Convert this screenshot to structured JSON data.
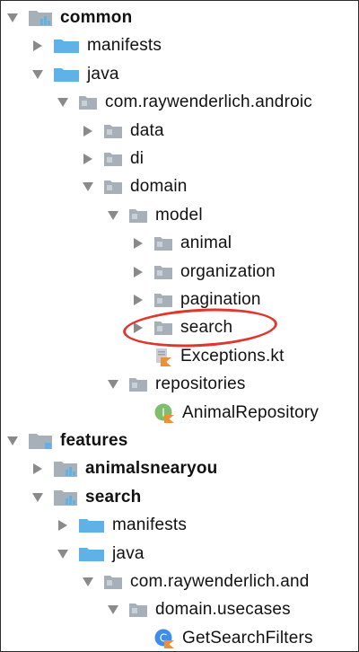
{
  "tree": {
    "rows": [
      {
        "label": "common",
        "depth": 0,
        "expanded": true,
        "icon": "module-folder-icon",
        "bold": true
      },
      {
        "label": "manifests",
        "depth": 1,
        "expanded": false,
        "icon": "folder-blue-icon",
        "bold": false
      },
      {
        "label": "java",
        "depth": 1,
        "expanded": true,
        "icon": "folder-blue-icon",
        "bold": false
      },
      {
        "label": "com.raywenderlich.androic",
        "depth": 2,
        "expanded": true,
        "icon": "package-folder-icon",
        "bold": false
      },
      {
        "label": "data",
        "depth": 3,
        "expanded": false,
        "icon": "package-folder-icon",
        "bold": false
      },
      {
        "label": "di",
        "depth": 3,
        "expanded": false,
        "icon": "package-folder-icon",
        "bold": false
      },
      {
        "label": "domain",
        "depth": 3,
        "expanded": true,
        "icon": "package-folder-icon",
        "bold": false
      },
      {
        "label": "model",
        "depth": 4,
        "expanded": true,
        "icon": "package-folder-icon",
        "bold": false
      },
      {
        "label": "animal",
        "depth": 5,
        "expanded": false,
        "icon": "package-folder-icon",
        "bold": false
      },
      {
        "label": "organization",
        "depth": 5,
        "expanded": false,
        "icon": "package-folder-icon",
        "bold": false
      },
      {
        "label": "pagination",
        "depth": 5,
        "expanded": false,
        "icon": "package-folder-icon",
        "bold": false
      },
      {
        "label": "search",
        "depth": 5,
        "expanded": false,
        "icon": "package-folder-icon",
        "bold": false,
        "highlighted": true
      },
      {
        "label": "Exceptions.kt",
        "depth": 5,
        "expanded": null,
        "icon": "kotlin-file-icon",
        "bold": false
      },
      {
        "label": "repositories",
        "depth": 4,
        "expanded": true,
        "icon": "package-folder-icon",
        "bold": false
      },
      {
        "label": "AnimalRepository",
        "depth": 5,
        "expanded": null,
        "icon": "kotlin-interface-icon",
        "bold": false
      },
      {
        "label": "features",
        "depth": 0,
        "expanded": true,
        "icon": "folder-plain-icon",
        "bold": true
      },
      {
        "label": "animalsnearyou",
        "depth": 1,
        "expanded": false,
        "icon": "module-folder-icon",
        "bold": true
      },
      {
        "label": "search",
        "depth": 1,
        "expanded": true,
        "icon": "module-folder-icon",
        "bold": true
      },
      {
        "label": "manifests",
        "depth": 2,
        "expanded": false,
        "icon": "folder-blue-icon",
        "bold": false
      },
      {
        "label": "java",
        "depth": 2,
        "expanded": true,
        "icon": "folder-blue-icon",
        "bold": false
      },
      {
        "label": "com.raywenderlich.and",
        "depth": 3,
        "expanded": true,
        "icon": "package-folder-icon",
        "bold": false
      },
      {
        "label": "domain.usecases",
        "depth": 4,
        "expanded": true,
        "icon": "package-folder-icon",
        "bold": false
      },
      {
        "label": "GetSearchFilters",
        "depth": 5,
        "expanded": null,
        "icon": "kotlin-class-icon",
        "bold": false
      }
    ]
  },
  "colors": {
    "folder_blue": "#5fb2e6",
    "folder_gray": "#a7b0b8",
    "package_dot": "#c9d0d6",
    "arrow": "#8a8a8a",
    "highlight": "#e0362b",
    "kotlin_orange": "#f18e33",
    "interface_green": "#7fbf6b",
    "class_blue": "#3e8ee8"
  }
}
